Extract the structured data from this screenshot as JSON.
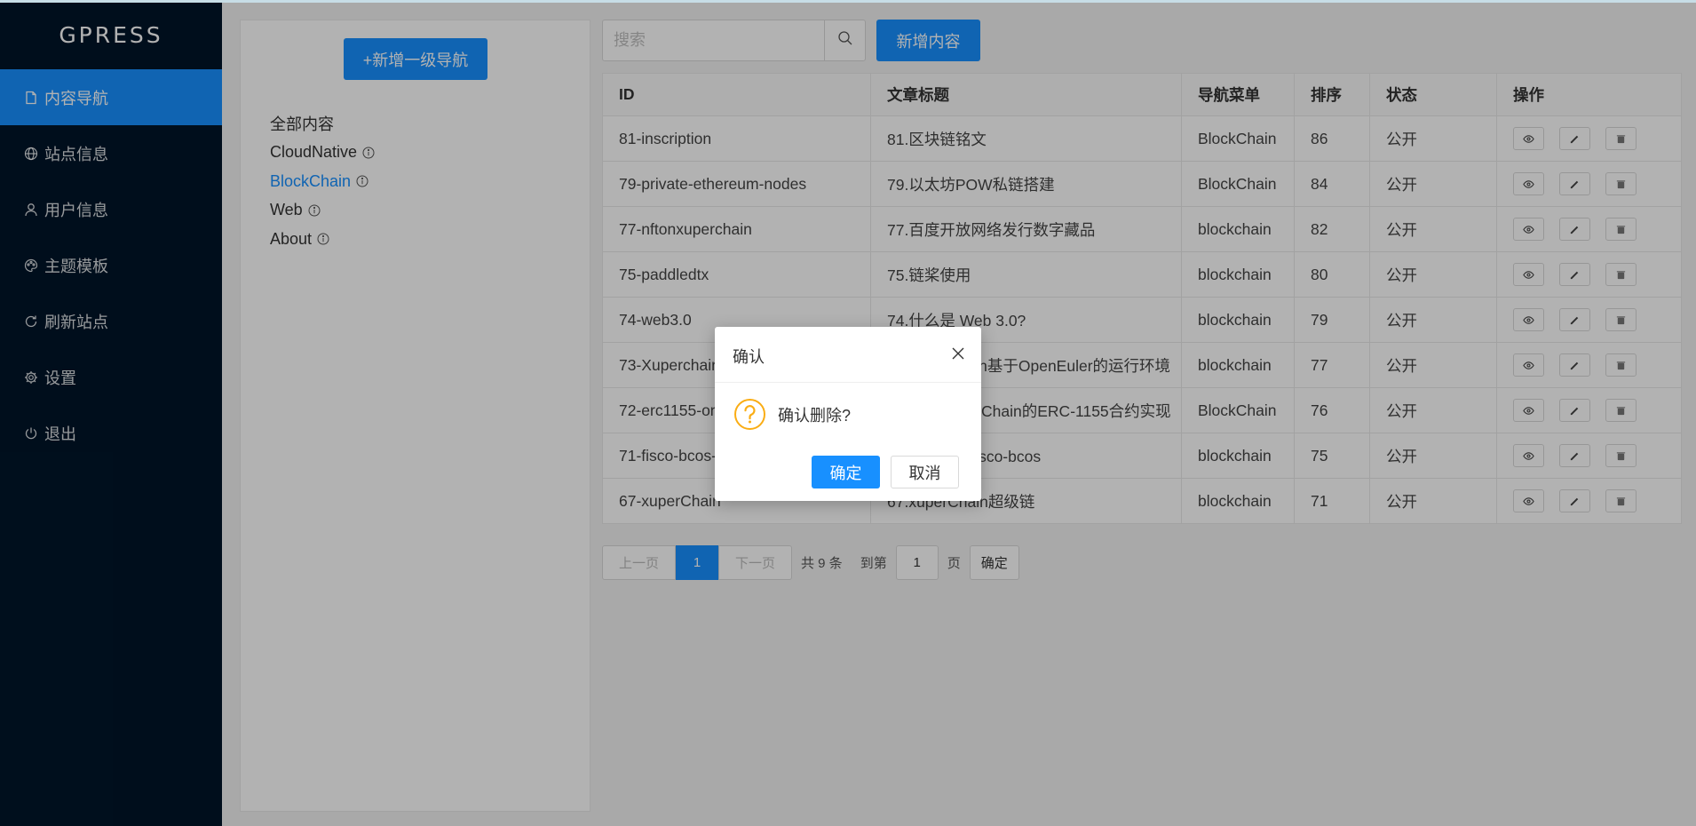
{
  "sidebar": {
    "brand": "GPRESS",
    "items": [
      {
        "label": "内容导航",
        "icon": "document-icon",
        "active": true
      },
      {
        "label": "站点信息",
        "icon": "globe-icon"
      },
      {
        "label": "用户信息",
        "icon": "user-icon"
      },
      {
        "label": "主题模板",
        "icon": "palette-icon"
      },
      {
        "label": "刷新站点",
        "icon": "refresh-icon"
      },
      {
        "label": "设置",
        "icon": "gear-icon"
      },
      {
        "label": "退出",
        "icon": "power-icon"
      }
    ]
  },
  "nav_panel": {
    "add_button": "+新增一级导航",
    "items": [
      {
        "label": "全部内容",
        "has_info": false
      },
      {
        "label": "CloudNative",
        "has_info": true
      },
      {
        "label": "BlockChain",
        "has_info": true,
        "selected": true
      },
      {
        "label": "Web",
        "has_info": true
      },
      {
        "label": "About",
        "has_info": true
      }
    ]
  },
  "toolbar": {
    "search_placeholder": "搜索",
    "new_content_button": "新增内容"
  },
  "table": {
    "headers": [
      "ID",
      "文章标题",
      "导航菜单",
      "排序",
      "状态",
      "操作"
    ],
    "rows": [
      {
        "id": "81-inscription",
        "title": "81.区块链铭文",
        "nav": "BlockChain",
        "order": "86",
        "status": "公开"
      },
      {
        "id": "79-private-ethereum-nodes",
        "title": "79.以太坊POW私链搭建",
        "nav": "BlockChain",
        "order": "84",
        "status": "公开"
      },
      {
        "id": "77-nftonxuperchain",
        "title": "77.百度开放网络发行数字藏品",
        "nav": "blockchain",
        "order": "82",
        "status": "公开"
      },
      {
        "id": "75-paddledtx",
        "title": "75.链桨使用",
        "nav": "blockchain",
        "order": "80",
        "status": "公开"
      },
      {
        "id": "74-web3.0",
        "title": "74.什么是 Web 3.0?",
        "nav": "blockchain",
        "order": "79",
        "status": "公开"
      },
      {
        "id": "73-Xuperchain",
        "title": "73.Xuperchain基于OpenEuler的运行环境",
        "nav": "blockchain",
        "order": "77",
        "status": "公开"
      },
      {
        "id": "72-erc1155-on",
        "title": "72.基于XuperChain的ERC-1155合约实现",
        "nav": "BlockChain",
        "order": "76",
        "status": "公开"
      },
      {
        "id": "71-fisco-bcos-",
        "title": "71.快速部署fisco-bcos",
        "nav": "blockchain",
        "order": "75",
        "status": "公开"
      },
      {
        "id": "67-xuperChain",
        "title": "67.xuperChain超级链",
        "nav": "blockchain",
        "order": "71",
        "status": "公开"
      }
    ]
  },
  "pagination": {
    "prev": "上一页",
    "current": "1",
    "next": "下一页",
    "total": "共 9 条",
    "goto_label": "到第",
    "goto_value": "1",
    "page_suffix": "页",
    "confirm": "确定"
  },
  "modal": {
    "title": "确认",
    "message": "确认删除?",
    "ok": "确定",
    "cancel": "取消"
  },
  "colors": {
    "sidebar_bg": "#001529",
    "primary": "#1890ff",
    "warning": "#faad14"
  }
}
